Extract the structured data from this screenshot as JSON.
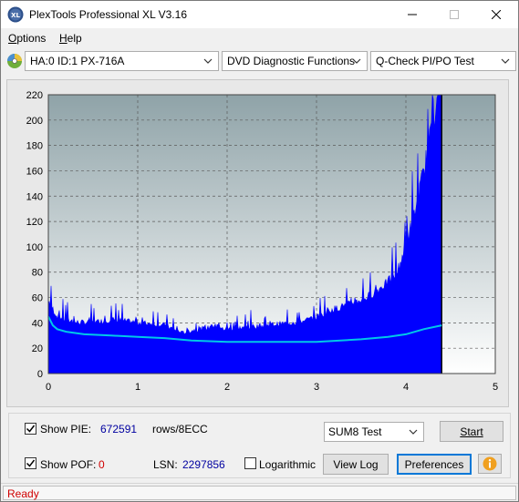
{
  "window": {
    "title": "PlexTools Professional XL V3.16"
  },
  "menu": {
    "options": "Options",
    "options_rest": "ptions",
    "options_key": "O",
    "help": "Help",
    "help_key": "H",
    "help_rest": "elp"
  },
  "toolbar": {
    "drive": "HA:0 ID:1  PX-716A",
    "function": "DVD Diagnostic Functions",
    "test": "Q-Check PI/PO Test"
  },
  "chart_data": {
    "type": "area",
    "xlim": [
      0,
      5
    ],
    "ylim": [
      0,
      220
    ],
    "x_ticks": [
      "0",
      "1",
      "2",
      "3",
      "4",
      "5"
    ],
    "y_ticks": [
      "0",
      "20",
      "40",
      "60",
      "80",
      "100",
      "120",
      "140",
      "160",
      "180",
      "200",
      "220"
    ],
    "data_end_x": 4.4,
    "series": [
      {
        "kind": "pie-bars",
        "color": "#0000ff",
        "x": [
          0,
          0.05,
          0.1,
          0.2,
          0.3,
          0.5,
          0.7,
          1.0,
          1.3,
          1.5,
          1.6,
          1.8,
          2.0,
          2.3,
          2.6,
          2.8,
          3.0,
          3.2,
          3.4,
          3.6,
          3.8,
          3.9,
          4.0,
          4.1,
          4.2,
          4.3,
          4.35,
          4.4
        ],
        "y": [
          52,
          48,
          42,
          40,
          38,
          38,
          40,
          38,
          36,
          30,
          32,
          34,
          33,
          35,
          37,
          38,
          42,
          48,
          52,
          58,
          68,
          75,
          95,
          120,
          150,
          185,
          210,
          215
        ]
      },
      {
        "kind": "avg-line",
        "color": "#00c8e8",
        "x": [
          0,
          0.05,
          0.1,
          0.2,
          0.4,
          0.7,
          1.0,
          1.3,
          1.6,
          2.0,
          2.5,
          3.0,
          3.5,
          3.8,
          4.0,
          4.2,
          4.4
        ],
        "y": [
          45,
          38,
          35,
          33,
          31,
          30,
          29,
          28,
          26,
          25,
          25,
          25,
          27,
          29,
          31,
          35,
          38
        ]
      }
    ]
  },
  "controls": {
    "show_pie_label": "Show PIE:",
    "pie_value": "672591",
    "pie_unit": "rows/8ECC",
    "show_pof_label": "Show POF:",
    "pof_value": "0",
    "lsn_label": "LSN:",
    "lsn_value": "2297856",
    "logarithmic_label": "Logarithmic",
    "sum_test": "SUM8 Test",
    "start_button": "Start",
    "view_log_button": "View Log",
    "preferences_button": "Preferences"
  },
  "status": {
    "text": "Ready"
  },
  "colors": {
    "pie": "#0000ff",
    "avg": "#00c8e8",
    "status": "#d00000"
  }
}
